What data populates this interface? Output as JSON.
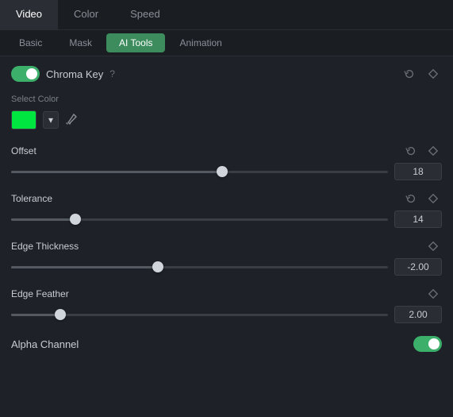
{
  "topTabs": {
    "items": [
      {
        "label": "Video",
        "active": true
      },
      {
        "label": "Color",
        "active": false
      },
      {
        "label": "Speed",
        "active": false
      }
    ]
  },
  "subTabs": {
    "items": [
      {
        "label": "Basic",
        "active": false
      },
      {
        "label": "Mask",
        "active": false
      },
      {
        "label": "AI Tools",
        "active": true
      },
      {
        "label": "Animation",
        "active": false
      }
    ]
  },
  "chromaKey": {
    "label": "Chroma Key",
    "helpIcon": "?",
    "enabled": true
  },
  "selectColor": {
    "label": "Select Color"
  },
  "offset": {
    "label": "Offset",
    "value": "18",
    "thumbPercent": 56
  },
  "tolerance": {
    "label": "Tolerance",
    "value": "14",
    "thumbPercent": 17
  },
  "edgeThickness": {
    "label": "Edge Thickness",
    "value": "-2.00",
    "thumbPercent": 39
  },
  "edgeFeather": {
    "label": "Edge Feather",
    "value": "2.00",
    "thumbPercent": 13
  },
  "alphaChannel": {
    "label": "Alpha Channel",
    "enabled": true
  },
  "icons": {
    "reset": "↺",
    "diamond": "◇",
    "eyedropper": "✒",
    "chevronDown": "▾",
    "help": "?"
  }
}
